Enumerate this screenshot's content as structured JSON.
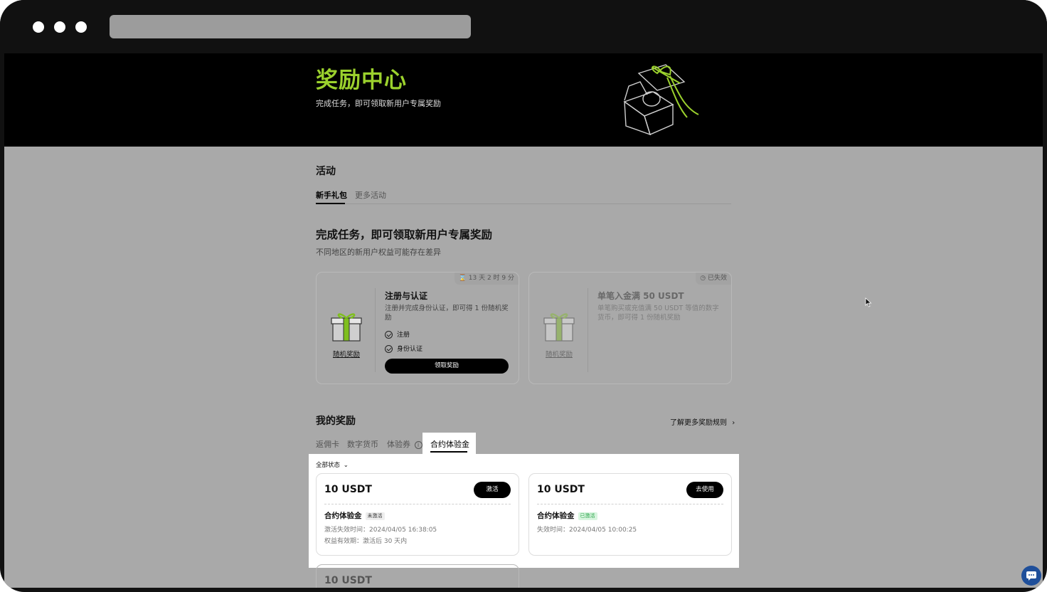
{
  "hero": {
    "title": "奖励中心",
    "subtitle": "完成任务，即可领取新用户专属奖励"
  },
  "activities": {
    "section_title": "活动",
    "tabs": [
      {
        "label": "新手礼包",
        "active": true
      },
      {
        "label": "更多活动",
        "active": false
      }
    ],
    "heading": "完成任务，即可领取新用户专属奖励",
    "note": "不同地区的新用户权益可能存在差异",
    "tasks": [
      {
        "timer": "13 天 2 时 9 分",
        "gift_label": "随机奖励",
        "title": "注册与认证",
        "desc": "注册并完成身份认证，即可得 1 份随机奖励",
        "steps": [
          "注册",
          "身份认证"
        ],
        "button": "领取奖励"
      },
      {
        "timer": "已失效",
        "gift_label": "随机奖励",
        "title": "单笔入金满 50 USDT",
        "desc": "单笔购买或充值满 50 USDT 等值的数字货币，即可得 1 份随机奖励"
      }
    ]
  },
  "my_rewards": {
    "section_title": "我的奖励",
    "rules_link": "了解更多奖励规则",
    "tabs": [
      {
        "label": "返佣卡",
        "active": false
      },
      {
        "label": "数字货币",
        "active": false
      },
      {
        "label": "体验券",
        "active": false
      },
      {
        "label": "合约体验金",
        "active": true
      }
    ],
    "filter": "全部状态",
    "cards": [
      {
        "amount": "10 USDT",
        "button": "激活",
        "name": "合约体验金",
        "badge": "未激活",
        "line1": "激活失效时间：2024/04/05 16:38:05",
        "line2": "权益有效期：激活后 30 天内"
      },
      {
        "amount": "10 USDT",
        "button": "去使用",
        "name": "合约体验金",
        "badge": "已激活",
        "line1": "失效时间：2024/04/05 10:00:25"
      }
    ],
    "partial_card_amount": "10 USDT"
  },
  "colors": {
    "accent": "#9bd12d",
    "badge_active_bg": "#d8f5df",
    "badge_active_text": "#2aa54a"
  }
}
